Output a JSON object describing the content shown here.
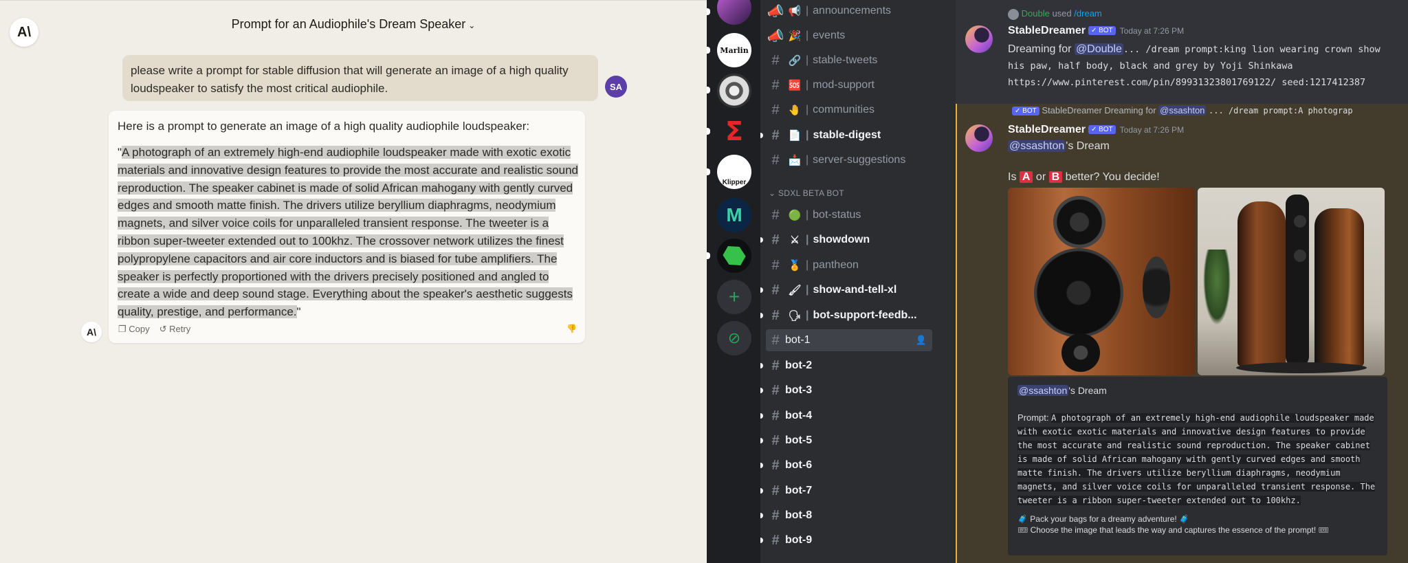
{
  "claude": {
    "logo": "A\\",
    "title": "Prompt for an Audiophile's Dream Speaker",
    "user_avatar": "SA",
    "user_message": "please write a prompt for stable diffusion that will generate an image of a high quality loudspeaker to satisfy the most critical audiophile.",
    "ai_intro": "Here is a prompt to generate an image of a high quality audiophile loudspeaker:",
    "ai_quote_open": "\"",
    "ai_prompt": "A photograph of an extremely high-end audiophile loudspeaker made with exotic exotic materials and innovative design features to provide the most accurate and realistic sound reproduction. The speaker cabinet is made of solid African mahogany with gently curved edges and smooth matte finish. The drivers utilize beryllium diaphragms, neodymium magnets, and silver voice coils for unparalleled transient response. The tweeter is a ribbon super-tweeter extended out to 100khz. The crossover network utilizes the finest polypropylene capacitors and air core inductors and is biased for tube amplifiers. The speaker is perfectly proportioned with the drivers precisely positioned and angled to create a wide and deep sound stage. Everything about the speaker's aesthetic suggests quality, prestige, and performance.",
    "ai_quote_close": "\"",
    "copy_label": "Copy",
    "retry_label": "Retry"
  },
  "discord": {
    "guild_labels": [
      "Marlin",
      "Klipper"
    ],
    "channels_top": [
      {
        "emoji": "📢",
        "name": "announcements"
      },
      {
        "emoji": "🎉",
        "name": "events"
      },
      {
        "emoji": "🔗",
        "name": "stable-tweets"
      },
      {
        "emoji": "🆘",
        "name": "mod-support"
      },
      {
        "emoji": "🤚",
        "name": "communities"
      },
      {
        "emoji": "📄",
        "name": "stable-digest"
      },
      {
        "emoji": "📩",
        "name": "server-suggestions"
      }
    ],
    "category": "SDXL BETA BOT",
    "channels_sdxl": [
      {
        "emoji": "🟢",
        "name": "bot-status"
      },
      {
        "emoji": "⚔",
        "name": "showdown"
      },
      {
        "emoji": "🏅",
        "name": "pantheon"
      },
      {
        "emoji": "🖌",
        "name": "show-and-tell-xl"
      },
      {
        "emoji": "🗣",
        "name": "bot-support-feedb..."
      }
    ],
    "bot_channels": [
      "bot-1",
      "bot-2",
      "bot-3",
      "bot-4",
      "bot-5",
      "bot-6",
      "bot-7",
      "bot-8",
      "bot-9"
    ],
    "msg1": {
      "reply_user": "Double",
      "reply_used": "used",
      "reply_cmd": "/dream",
      "author": "StableDreamer",
      "badge": "✓ BOT",
      "time": "Today at 7:26 PM",
      "dreaming_for": "Dreaming for",
      "mention": "@Double",
      "text": "... /dream prompt:king lion wearing crown show his paw, half body, black and grey by Yoji Shinkawa https://www.pinterest.com/pin/89931323801769122/ seed:1217412387"
    },
    "msg2": {
      "reply_badge": "✓ BOT",
      "reply_author": "StableDreamer",
      "reply_text": "Dreaming for",
      "reply_mention": "@ssashton",
      "reply_tail": "... /dream prompt:A photograp",
      "author": "StableDreamer",
      "badge": "✓ BOT",
      "time": "Today at 7:26 PM",
      "mention": "@ssashton",
      "dream_suffix": "'s Dream",
      "vote_pre": "Is",
      "vote_a": "A",
      "vote_or": "or",
      "vote_b": "B",
      "vote_post": "better? You decide!",
      "embed_mention": "@ssashton",
      "embed_suffix": "'s Dream",
      "embed_prompt_label": "Prompt:",
      "embed_prompt": "A photograph of an extremely high-end audiophile loudspeaker made with exotic exotic materials and innovative design features to provide the most accurate and realistic sound reproduction. The speaker cabinet is made of solid African mahogany with gently curved edges and smooth matte finish. The drivers utilize beryllium diaphragms, neodymium magnets, and silver voice coils for unparalleled transient response. The tweeter is a ribbon super-tweeter extended out to 100khz.",
      "footer1": "🧳 Pack your bags for a dreamy adventure! 🧳",
      "footer2": "🎟 Choose the image that leads the way and captures the essence of the prompt! 🎟"
    }
  }
}
